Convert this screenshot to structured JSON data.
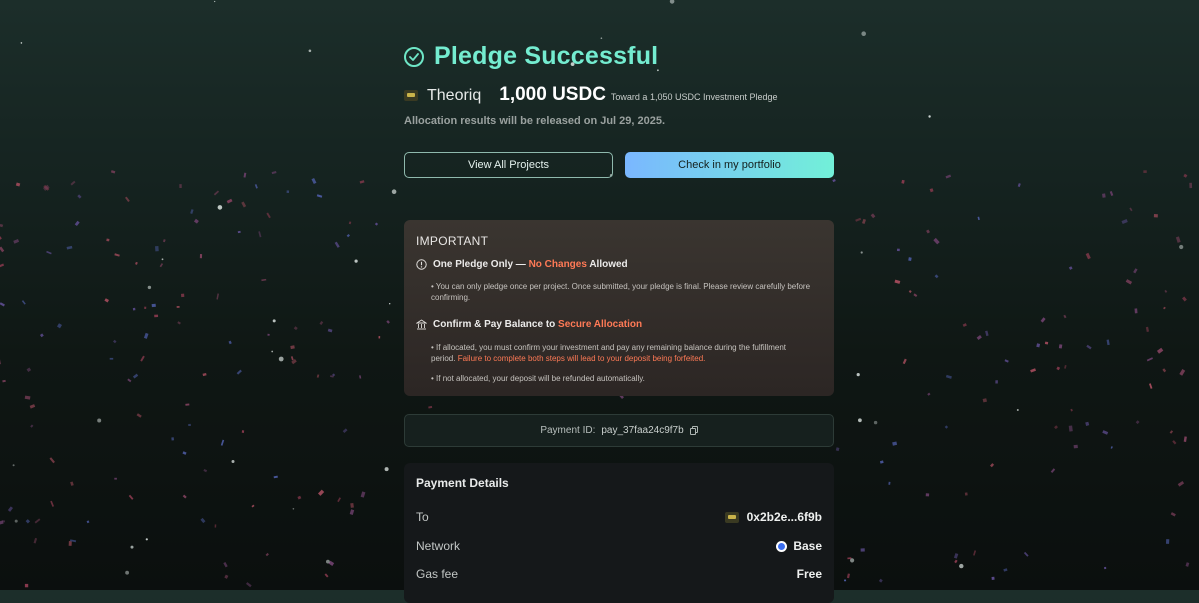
{
  "header": {
    "title": "Pledge Successful",
    "project_name": "Theoriq",
    "amount": "1,000 USDC",
    "toward": "Toward a 1,050 USDC Investment Pledge",
    "allocation_note": "Allocation results will be released on Jul 29, 2025."
  },
  "actions": {
    "view_all_label": "View All Projects",
    "portfolio_label": "Check in my portfolio"
  },
  "important": {
    "title": "IMPORTANT",
    "item1": {
      "prefix": "One Pledge Only — ",
      "highlight": "No Changes",
      "suffix": " Allowed",
      "bullet": "• You can only pledge once per project. Once submitted, your pledge is final. Please review carefully before confirming."
    },
    "item2": {
      "prefix": "Confirm & Pay Balance to ",
      "highlight": "Secure Allocation",
      "bullet_a_text": "• If allocated, you must confirm your investment and pay any remaining balance during the fulfillment period. ",
      "bullet_a_warning": "Failure to complete both steps will lead to your deposit being forfeited.",
      "bullet_b": "• If not allocated, your deposit will be refunded automatically."
    }
  },
  "payment": {
    "id_label": "Payment ID:",
    "id_value": "pay_37faa24c9f7b"
  },
  "details": {
    "title": "Payment Details",
    "rows": [
      {
        "key": "To",
        "value": "0x2b2e...6f9b"
      },
      {
        "key": "Network",
        "value": "Base"
      },
      {
        "key": "Gas fee",
        "value": "Free"
      }
    ]
  },
  "colors": {
    "accent": "#74ecd0",
    "warning": "#ff7a56"
  }
}
